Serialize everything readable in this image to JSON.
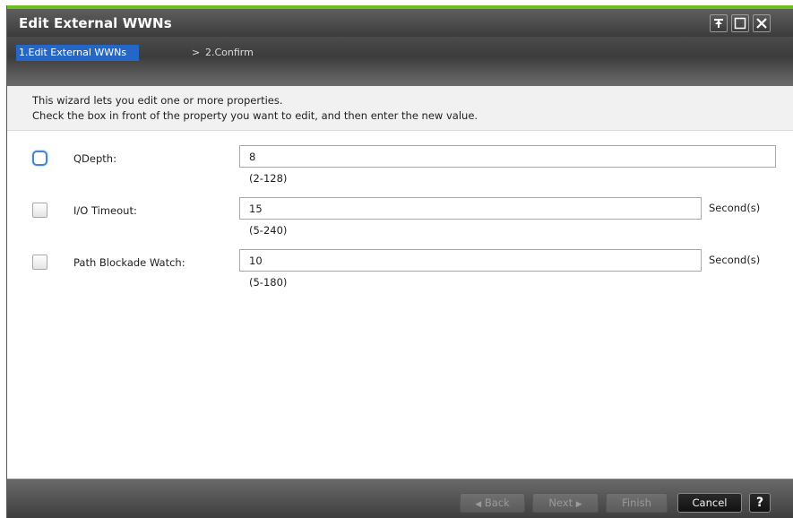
{
  "window": {
    "title": "Edit External WWNs",
    "controls": [
      "pin-icon",
      "maximize-icon",
      "close-icon"
    ]
  },
  "wizard": {
    "steps": [
      {
        "label": "1.Edit External WWNs",
        "active": true
      },
      {
        "label": "2.Confirm",
        "active": false
      }
    ],
    "separator": ">"
  },
  "instructions": {
    "line1": "This wizard lets you edit one or more properties.",
    "line2": "Check the box in front of the property you want to edit, and then enter the new value."
  },
  "fields": [
    {
      "label": "QDepth:",
      "value": "8",
      "range": "(2-128)",
      "unit": "",
      "checked": false,
      "focused": true
    },
    {
      "label": "I/O Timeout:",
      "value": "15",
      "range": "(5-240)",
      "unit": "Second(s)",
      "checked": false,
      "focused": false
    },
    {
      "label": "Path Blockade Watch:",
      "value": "10",
      "range": "(5-180)",
      "unit": "Second(s)",
      "checked": false,
      "focused": false
    }
  ],
  "footer": {
    "back": "Back",
    "next": "Next",
    "finish": "Finish",
    "cancel": "Cancel",
    "help": "?"
  },
  "colors": {
    "accent_green": "#6bbf1f",
    "active_step": "#2467c9",
    "focus_ring": "#3f86d8"
  }
}
